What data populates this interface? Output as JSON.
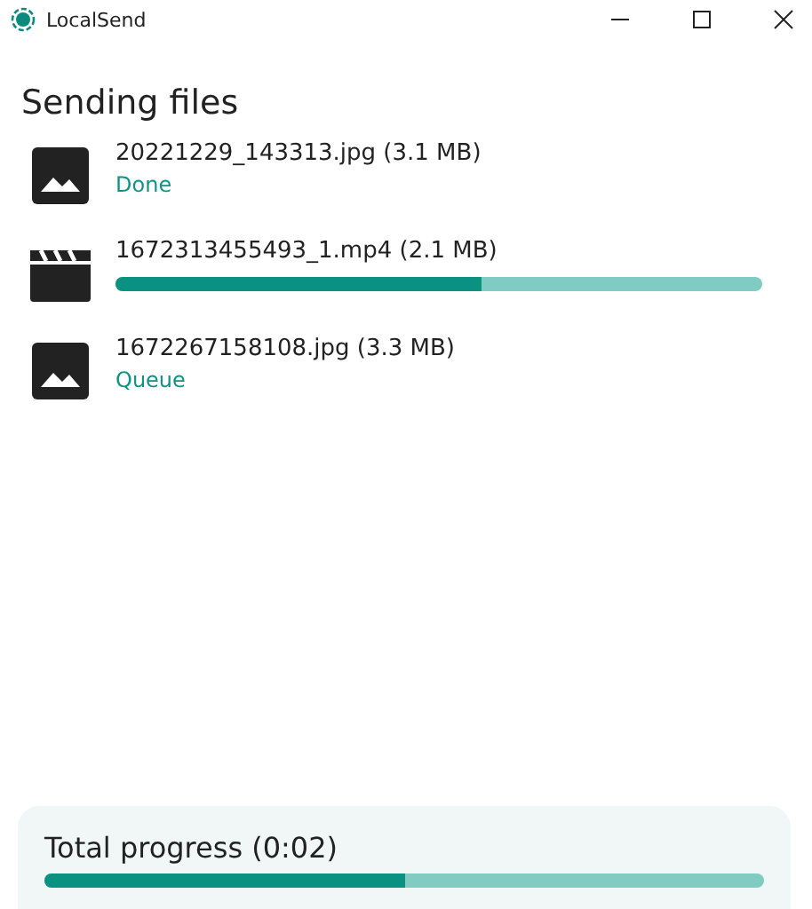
{
  "window": {
    "title": "LocalSend"
  },
  "heading": "Sending files",
  "files": [
    {
      "kind": "image",
      "name": "20221229_143313.jpg (3.1 MB)",
      "status": "Done"
    },
    {
      "kind": "video",
      "name": "1672313455493_1.mp4 (2.1 MB)",
      "level": 0.565
    },
    {
      "kind": "image",
      "name": "1672267158108.jpg (3.3 MB)",
      "status": "Queue"
    }
  ],
  "total": {
    "label": "Total progress (0:02)",
    "level": 0.5
  }
}
